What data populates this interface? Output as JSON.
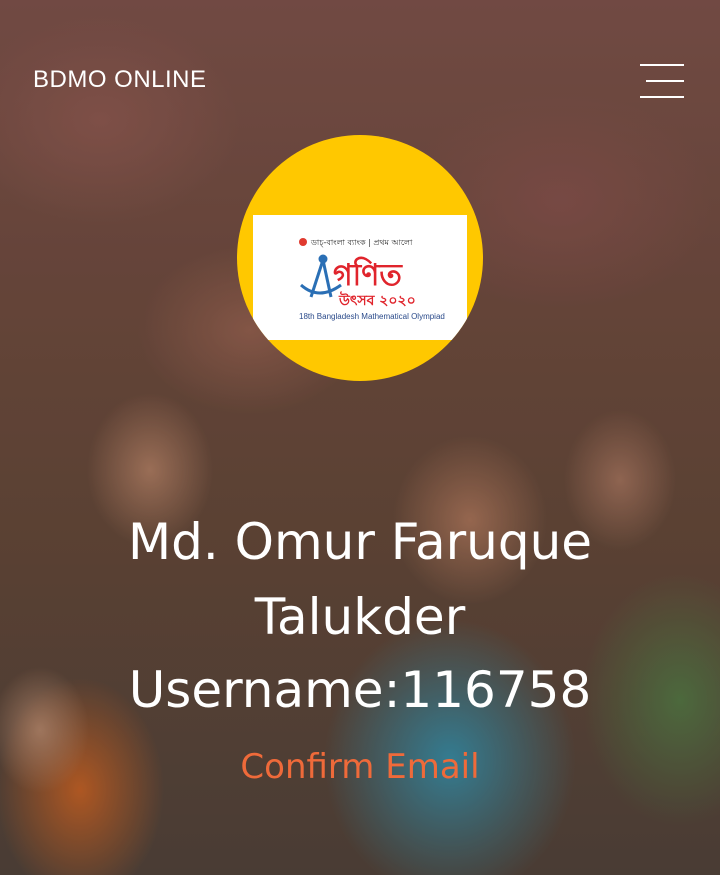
{
  "header": {
    "brand": "BDMO ONLINE",
    "menu_icon": "hamburger-menu-icon"
  },
  "logo": {
    "top_line": "ডাচ্-বাংলা ব্যাংক | প্রথম আলো",
    "title_bn": "গণিত",
    "subtitle_bn": "উৎসব ২০২০",
    "edition": "18th Bangladesh Mathematical Olympiad"
  },
  "profile": {
    "name_line1": "Md. Omur Faruque",
    "name_line2": "Talukder",
    "username_label": "Username:",
    "username_value": "116758"
  },
  "actions": {
    "confirm_email": "Confirm Email"
  },
  "colors": {
    "avatar_bg": "#ffc800",
    "link": "#ef6a3a",
    "text": "#ffffff"
  }
}
